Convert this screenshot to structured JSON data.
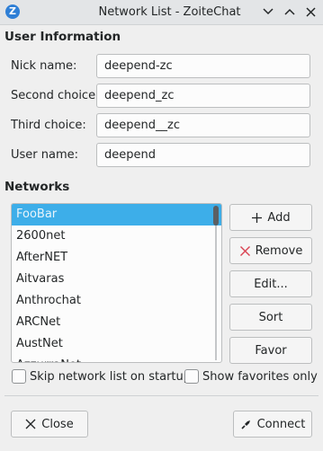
{
  "window": {
    "title": "Network List - ZoiteChat",
    "app_icon_letter": "Z"
  },
  "user_info": {
    "section_title": "User Information",
    "nick_label": "Nick name:",
    "nick_value": "deepend-zc",
    "second_label": "Second choice:",
    "second_value": "deepend_zc",
    "third_label": "Third choice:",
    "third_value": "deepend__zc",
    "username_label": "User name:",
    "username_value": "deepend"
  },
  "networks": {
    "section_title": "Networks",
    "items": [
      "FooBar",
      "2600net",
      "AfterNET",
      "Aitvaras",
      "Anthrochat",
      "ARCNet",
      "AustNet",
      "AzzurraNet"
    ],
    "selected_index": 0
  },
  "buttons": {
    "add": "Add",
    "remove": "Remove",
    "edit": "Edit...",
    "sort": "Sort",
    "favor": "Favor"
  },
  "options": {
    "skip_label": "Skip network list on startup",
    "skip_checked": false,
    "favorites_label": "Show favorites only",
    "favorites_checked": false
  },
  "footer": {
    "close": "Close",
    "connect": "Connect"
  },
  "colors": {
    "selection": "#3daee9",
    "window_bg": "#efefef",
    "remove_icon": "#da4453"
  }
}
